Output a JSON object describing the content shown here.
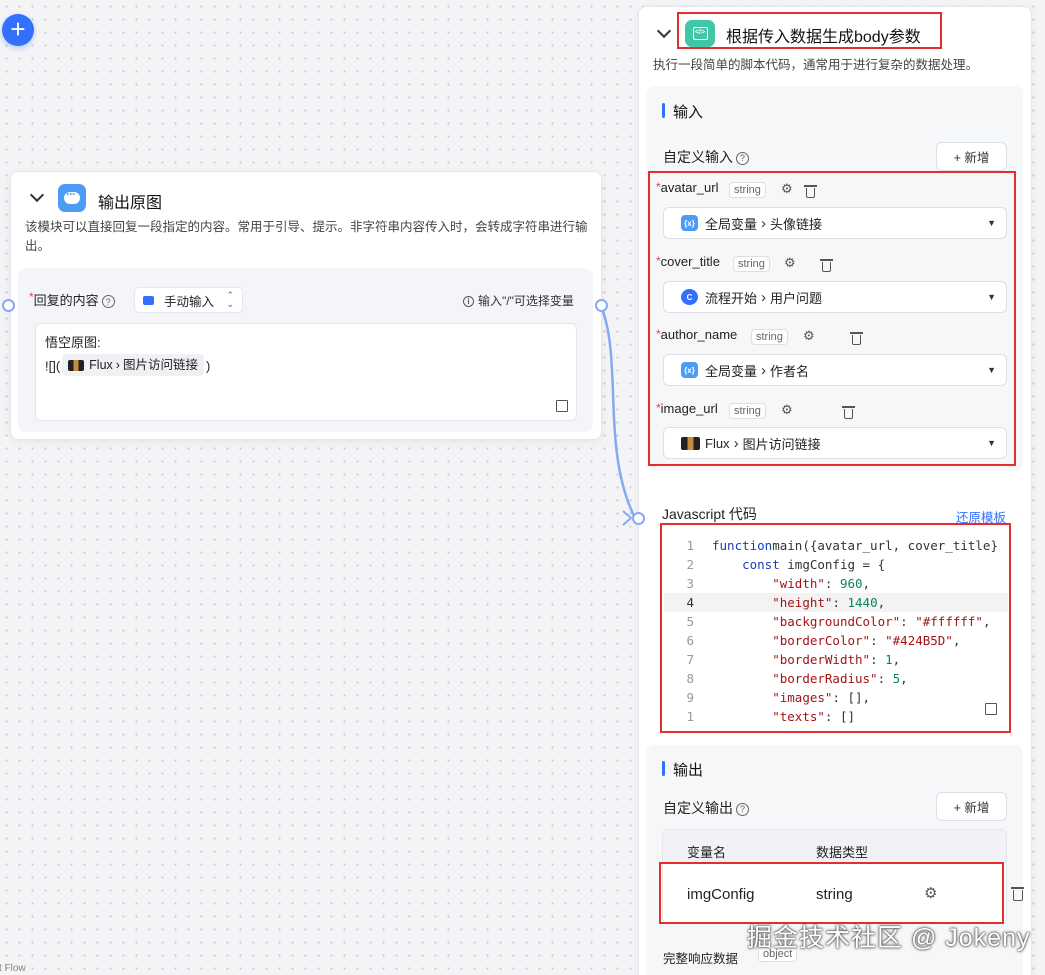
{
  "canvas": {
    "add_button": "+",
    "bottom_label": "ct Flow"
  },
  "reply_node": {
    "title": "输出原图",
    "description": "该模块可以直接回复一段指定的内容。常用于引导、提示。非字符串内容传入时，会转成字符串进行输出。",
    "field_label": "回复的内容",
    "required_mark": "*",
    "mode": "手动输入",
    "hint": "输入\"/\"可选择变量",
    "content_line1": "悟空原图:",
    "content_prefix": "![](",
    "content_var_source": "Flux",
    "content_var_name": "图片访问链接",
    "content_suffix": ")"
  },
  "code_node": {
    "title": "根据传入数据生成body参数",
    "description": "执行一段简单的脚本代码，通常用于进行复杂的数据处理。",
    "input_section": "输入",
    "custom_input_label": "自定义输入",
    "add_label": "+ 新增",
    "inputs": [
      {
        "name": "avatar_url",
        "type": "string",
        "source": "全局变量",
        "variable": "头像链接",
        "source_icon": "global-variable-icon"
      },
      {
        "name": "cover_title",
        "type": "string",
        "source": "流程开始",
        "variable": "用户问题",
        "source_icon": "flow-start-icon"
      },
      {
        "name": "author_name",
        "type": "string",
        "source": "全局变量",
        "variable": "作者名",
        "source_icon": "global-variable-icon"
      },
      {
        "name": "image_url",
        "type": "string",
        "source": "Flux",
        "variable": "图片访问链接",
        "source_icon": "flux-thumbnail"
      }
    ],
    "code_label": "Javascript 代码",
    "restore_label": "还原模板",
    "code_lines": [
      {
        "n": "1",
        "parts": [
          [
            "kw",
            "function"
          ],
          [
            "",
            "main({avatar_url, cover_title}"
          ]
        ]
      },
      {
        "n": "2",
        "parts": [
          [
            "",
            "    "
          ],
          [
            "kw",
            "const"
          ],
          [
            "",
            " imgConfig = {"
          ]
        ]
      },
      {
        "n": "3",
        "parts": [
          [
            "",
            "        "
          ],
          [
            "str",
            "\"width\""
          ],
          [
            "",
            ": "
          ],
          [
            "num",
            "960"
          ],
          [
            "",
            ","
          ]
        ]
      },
      {
        "n": "4",
        "parts": [
          [
            "",
            "        "
          ],
          [
            "str",
            "\"height\""
          ],
          [
            "",
            ": "
          ],
          [
            "num",
            "1440"
          ],
          [
            "",
            ","
          ]
        ]
      },
      {
        "n": "5",
        "parts": [
          [
            "",
            "        "
          ],
          [
            "str",
            "\"backgroundColor\""
          ],
          [
            "",
            ": "
          ],
          [
            "str",
            "\"#ffffff\""
          ],
          [
            "",
            ","
          ]
        ]
      },
      {
        "n": "6",
        "parts": [
          [
            "",
            "        "
          ],
          [
            "str",
            "\"borderColor\""
          ],
          [
            "",
            ": "
          ],
          [
            "str",
            "\"#424B5D\""
          ],
          [
            "",
            ","
          ]
        ]
      },
      {
        "n": "7",
        "parts": [
          [
            "",
            "        "
          ],
          [
            "str",
            "\"borderWidth\""
          ],
          [
            "",
            ": "
          ],
          [
            "num",
            "1"
          ],
          [
            "",
            ","
          ]
        ]
      },
      {
        "n": "8",
        "parts": [
          [
            "",
            "        "
          ],
          [
            "str",
            "\"borderRadius\""
          ],
          [
            "",
            ": "
          ],
          [
            "num",
            "5"
          ],
          [
            "",
            ","
          ]
        ]
      },
      {
        "n": "9",
        "parts": [
          [
            "",
            "        "
          ],
          [
            "str",
            "\"images\""
          ],
          [
            "",
            ": [],"
          ]
        ]
      },
      {
        "n": "1",
        "parts": [
          [
            "",
            "        "
          ],
          [
            "str",
            "\"texts\""
          ],
          [
            "",
            ": []"
          ]
        ]
      }
    ],
    "active_line_index": 3,
    "output_section": "输出",
    "custom_output_label": "自定义输出",
    "output_table_headers": [
      "变量名",
      "数据类型"
    ],
    "outputs": [
      {
        "name": "imgConfig",
        "type": "string"
      }
    ],
    "full_response_label": "完整响应数据",
    "full_response_type": "object"
  },
  "watermark": "掘金技术社区 @ Jokeny",
  "colors": {
    "accent": "#3370ff",
    "annotation_red": "#e52d2d",
    "code_icon": "#41c7a7",
    "reply_icon": "#4e9bf5"
  }
}
